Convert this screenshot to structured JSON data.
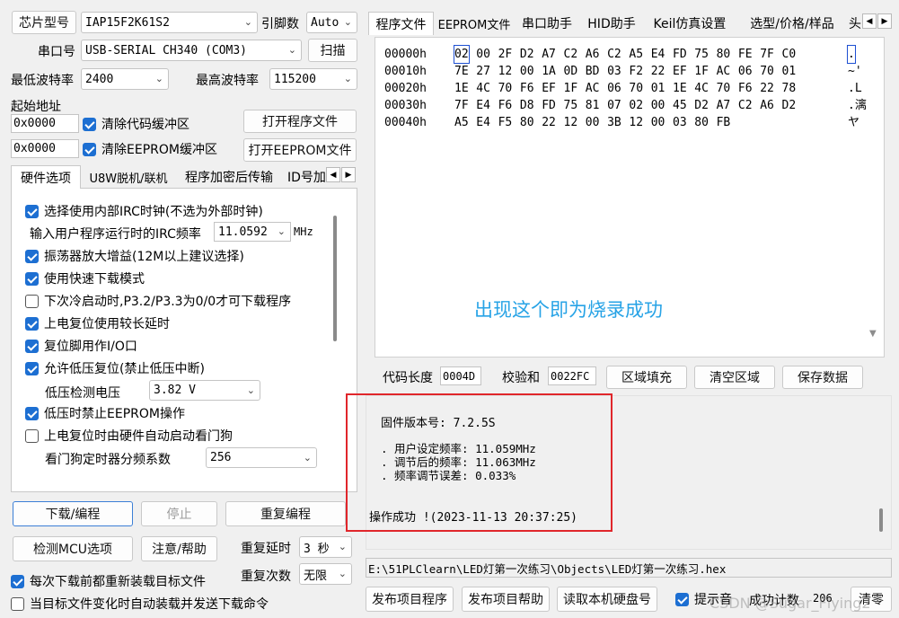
{
  "chip": {
    "label": "芯片型号",
    "value": "IAP15F2K61S2",
    "pins_label": "引脚数",
    "pins_value": "Auto"
  },
  "port": {
    "label": "串口号",
    "value": "USB-SERIAL CH340 (COM3)",
    "scan_label": "扫描"
  },
  "baud": {
    "min_label": "最低波特率",
    "min_value": "2400",
    "max_label": "最高波特率",
    "max_value": "115200"
  },
  "start": {
    "title": "起始地址",
    "addr1": "0x0000",
    "clear_code_label": "清除代码缓冲区",
    "open_prog_label": "打开程序文件",
    "addr2": "0x0000",
    "clear_eeprom_label": "清除EEPROM缓冲区",
    "open_eeprom_label": "打开EEPROM文件"
  },
  "left_tabs": [
    "硬件选项",
    "U8W脱机/联机",
    "程序加密后传输",
    "ID号加"
  ],
  "options": {
    "irc": "选择使用内部IRC时钟(不选为外部时钟)",
    "freq_label": "输入用户程序运行时的IRC频率",
    "freq_value": "11.0592",
    "freq_unit": "MHz",
    "osc_gain": "振荡器放大增益(12M以上建议选择)",
    "fast_dl": "使用快速下载模式",
    "cold_start": "下次冷启动时,P3.2/P3.3为0/0才可下载程序",
    "long_delay": "上电复位使用较长延时",
    "reset_io": "复位脚用作I/O口",
    "low_volt_reset": "允许低压复位(禁止低压中断)",
    "volt_label": "低压检测电压",
    "volt_value": "3.82 V",
    "no_eeprom": "低压时禁止EEPROM操作",
    "watchdog": "上电复位时由硬件自动启动看门狗",
    "wdt_label": "看门狗定时器分频系数",
    "wdt_value": "256"
  },
  "actions": {
    "download": "下载/编程",
    "stop": "停止",
    "repeat": "重复编程",
    "detect": "检测MCU选项",
    "help": "注意/帮助",
    "repeat_delay_label": "重复延时",
    "repeat_delay_value": "3 秒",
    "repeat_count_label": "重复次数",
    "repeat_count_value": "无限",
    "reload_label": "每次下载前都重新装载目标文件",
    "auto_label": "当目标文件变化时自动装载并发送下载命令"
  },
  "right_tabs": [
    "程序文件",
    "EEPROM文件",
    "串口助手",
    "HID助手",
    "Keil仿真设置",
    "选型/价格/样品",
    "头"
  ],
  "hex": {
    "rows": [
      {
        "addr": "00000h",
        "bytes": [
          "02",
          "00",
          "2F",
          "D2",
          "A7",
          "C2",
          "A6",
          "C2",
          "A5",
          "E4",
          "FD",
          "75",
          "80",
          "FE",
          "7F",
          "C0"
        ],
        "ascii": "."
      },
      {
        "addr": "00010h",
        "bytes": [
          "7E",
          "27",
          "12",
          "00",
          "1A",
          "0D",
          "BD",
          "03",
          "F2",
          "22",
          "EF",
          "1F",
          "AC",
          "06",
          "70",
          "01"
        ],
        "ascii": "~'"
      },
      {
        "addr": "00020h",
        "bytes": [
          "1E",
          "4C",
          "70",
          "F6",
          "EF",
          "1F",
          "AC",
          "06",
          "70",
          "01",
          "1E",
          "4C",
          "70",
          "F6",
          "22",
          "78"
        ],
        "ascii": ".L"
      },
      {
        "addr": "00030h",
        "bytes": [
          "7F",
          "E4",
          "F6",
          "D8",
          "FD",
          "75",
          "81",
          "07",
          "02",
          "00",
          "45",
          "D2",
          "A7",
          "C2",
          "A6",
          "D2"
        ],
        "ascii": ".漓"
      },
      {
        "addr": "00040h",
        "bytes": [
          "A5",
          "E4",
          "F5",
          "80",
          "22",
          "12",
          "00",
          "3B",
          "12",
          "00",
          "03",
          "80",
          "FB"
        ],
        "ascii": "ヤ"
      }
    ],
    "annotation": "出现这个即为烧录成功"
  },
  "code_info": {
    "length_label": "代码长度",
    "length_value": "0004D",
    "checksum_label": "校验和",
    "checksum_value": "0022FC",
    "fill_label": "区域填充",
    "clear_label": "清空区域",
    "save_label": "保存数据"
  },
  "log": {
    "firmware": "固件版本号: 7.2.5S",
    "line1": ". 用户设定频率: 11.059MHz",
    "line2": ". 调节后的频率: 11.063MHz",
    "line3": ". 频率调节误差: 0.033%",
    "success": "操作成功 !(2023-11-13 20:37:25)"
  },
  "file_path": "E:\\51PLClearn\\LED灯第一次练习\\Objects\\LED灯第一次练习.hex",
  "bottom": {
    "publish_prog": "发布项目程序",
    "publish_help": "发布项目帮助",
    "read_disk": "读取本机硬盘号",
    "prompt_label": "提示音",
    "success_count_label": "成功计数",
    "success_count": "206",
    "clear_label": "清零"
  },
  "watermark": "CSDN @Sugar_Flying2",
  "colors": {
    "accent": "#1d6fd2",
    "annotation": "#27a3e6",
    "highlight_border": "#e0262b"
  }
}
